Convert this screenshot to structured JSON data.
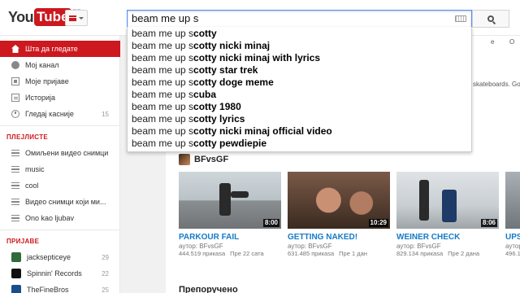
{
  "masthead": {
    "logo_you": "You",
    "logo_tube": "Tube",
    "region": "RS",
    "search_value": "beam me up s",
    "search_button_icon": "search-icon"
  },
  "suggestions": [
    {
      "prefix": "beam me up s",
      "suffix": "cotty"
    },
    {
      "prefix": "beam me up s",
      "suffix": "cotty nicki minaj"
    },
    {
      "prefix": "beam me up s",
      "suffix": "cotty nicki minaj with lyrics"
    },
    {
      "prefix": "beam me up s",
      "suffix": "cotty star trek"
    },
    {
      "prefix": "beam me up s",
      "suffix": "cotty doge meme"
    },
    {
      "prefix": "beam me up s",
      "suffix": "cuba"
    },
    {
      "prefix": "beam me up s",
      "suffix": "cotty 1980"
    },
    {
      "prefix": "beam me up s",
      "suffix": "cotty lyrics"
    },
    {
      "prefix": "beam me up s",
      "suffix": "cotty nicki minaj official video"
    },
    {
      "prefix": "beam me up s",
      "suffix": "cotty pewdiepie"
    }
  ],
  "guide": {
    "main_items": [
      {
        "label": "Шта да гледате",
        "icon": "home-icon"
      },
      {
        "label": "Мој канал",
        "icon": "user-icon"
      },
      {
        "label": "Моје пријаве",
        "icon": "subscriptions-icon"
      },
      {
        "label": "Историја",
        "icon": "history-icon"
      },
      {
        "label": "Гледај касније",
        "icon": "clock-icon",
        "count": "15"
      }
    ],
    "playlists_title": "ПЛЕЈЛИСТЕ",
    "playlists": [
      {
        "label": "Омиљени видео снимци"
      },
      {
        "label": "music"
      },
      {
        "label": "cool"
      },
      {
        "label": "Видео снимци који ми..."
      },
      {
        "label": "Ono kao ljubav"
      }
    ],
    "subscriptions_title": "ПРИЈАВЕ",
    "subscriptions": [
      {
        "label": "jacksepticeye",
        "count": "29",
        "color": "#2f6b3a"
      },
      {
        "label": "Spinnin' Records",
        "count": "22",
        "color": "#111111"
      },
      {
        "label": "TheFineBros",
        "count": "25",
        "color": "#1a4e8a"
      }
    ]
  },
  "main": {
    "right_tab_1": "е",
    "right_tab_2": "О",
    "fragment_text": "skateboards. Go",
    "channel_name": "BFvsGF",
    "videos": [
      {
        "title": "PARKOUR FAIL",
        "author": "аутор: BFvsGF",
        "views": "444.519 прикаѕа",
        "ago": "Пре 22 сата",
        "duration": "8:00"
      },
      {
        "title": "GETTING NAKED!",
        "author": "аутор: BFvsGF",
        "views": "631.485 прикаѕа",
        "ago": "Пре 1 дан",
        "duration": "10:29"
      },
      {
        "title": "WEINER CHECK",
        "author": "аутор: BFvsGF",
        "views": "829.134 прикаѕа",
        "ago": "Пре 2 дана",
        "duration": "8:06"
      },
      {
        "title": "UPS",
        "author": "аутор",
        "views": "496.1",
        "ago": "",
        "duration": ""
      }
    ],
    "recommended_title": "Препоручено"
  },
  "colors": {
    "brand_red": "#cc181e",
    "link_blue": "#167ac6",
    "focus_blue": "#4d90fe"
  }
}
